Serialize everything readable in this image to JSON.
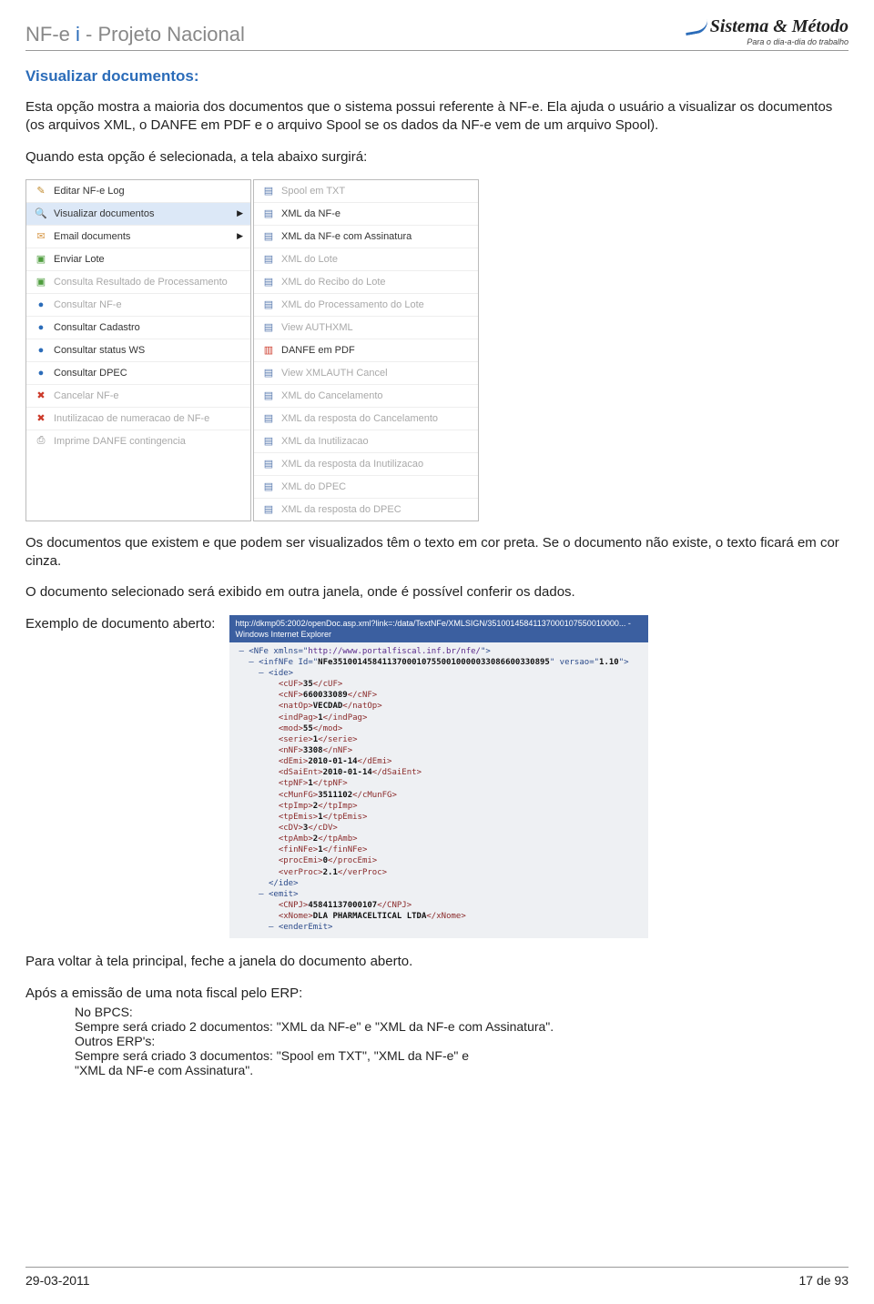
{
  "header": {
    "left_prefix": "NF-e ",
    "left_i": "i",
    "left_suffix": " - Projeto Nacional",
    "brand_name": "Sistema & Método",
    "brand_tag": "Para o dia-a-dia do trabalho"
  },
  "section_title": "Visualizar documentos:",
  "p1": "Esta opção mostra a maioria dos documentos que o sistema possui referente à NF-e. Ela ajuda o usuário a visualizar os documentos (os arquivos XML, o DANFE em PDF e o arquivo Spool se os dados da NF-e vem de um arquivo Spool).",
  "p2": "Quando esta opção é selecionada, a tela abaixo surgirá:",
  "menu_left": [
    {
      "icon": "pencil",
      "label": "Editar NF-e Log",
      "dim": false,
      "hl": false,
      "arrow": false
    },
    {
      "icon": "mag",
      "label": "Visualizar documentos",
      "dim": false,
      "hl": true,
      "arrow": true
    },
    {
      "icon": "mail",
      "label": "Email documents",
      "dim": false,
      "hl": false,
      "arrow": true
    },
    {
      "icon": "green",
      "label": "Enviar Lote",
      "dim": false,
      "hl": false,
      "arrow": false
    },
    {
      "icon": "green",
      "label": "Consulta Resultado de Processamento",
      "dim": true,
      "hl": false,
      "arrow": false
    },
    {
      "icon": "blue",
      "label": "Consultar NF-e",
      "dim": true,
      "hl": false,
      "arrow": false
    },
    {
      "icon": "blue",
      "label": "Consultar Cadastro",
      "dim": false,
      "hl": false,
      "arrow": false
    },
    {
      "icon": "blue",
      "label": "Consultar status WS",
      "dim": false,
      "hl": false,
      "arrow": false
    },
    {
      "icon": "blue",
      "label": "Consultar DPEC",
      "dim": false,
      "hl": false,
      "arrow": false
    },
    {
      "icon": "red",
      "label": "Cancelar NF-e",
      "dim": true,
      "hl": false,
      "arrow": false
    },
    {
      "icon": "red",
      "label": "Inutilizacao de numeracao de NF-e",
      "dim": true,
      "hl": false,
      "arrow": false
    },
    {
      "icon": "print",
      "label": "Imprime DANFE contingencia",
      "dim": true,
      "hl": false,
      "arrow": false
    }
  ],
  "menu_right": [
    {
      "icon": "doc",
      "label": "Spool em TXT",
      "dim": true
    },
    {
      "icon": "doc",
      "label": "XML da NF-e",
      "dim": false
    },
    {
      "icon": "doc",
      "label": "XML da NF-e com Assinatura",
      "dim": false
    },
    {
      "icon": "doc",
      "label": "XML do Lote",
      "dim": true
    },
    {
      "icon": "doc",
      "label": "XML do Recibo do Lote",
      "dim": true
    },
    {
      "icon": "doc",
      "label": "XML do Processamento do Lote",
      "dim": true
    },
    {
      "icon": "doc",
      "label": "View AUTHXML",
      "dim": true
    },
    {
      "icon": "pdf",
      "label": "DANFE em PDF",
      "dim": false
    },
    {
      "icon": "doc",
      "label": "View XMLAUTH Cancel",
      "dim": true
    },
    {
      "icon": "doc",
      "label": "XML do Cancelamento",
      "dim": true
    },
    {
      "icon": "doc",
      "label": "XML da resposta do Cancelamento",
      "dim": true
    },
    {
      "icon": "doc",
      "label": "XML da Inutilizacao",
      "dim": true
    },
    {
      "icon": "doc",
      "label": "XML da resposta da Inutilizacao",
      "dim": true
    },
    {
      "icon": "doc",
      "label": "XML do DPEC",
      "dim": true
    },
    {
      "icon": "doc",
      "label": "XML da resposta do DPEC",
      "dim": true
    }
  ],
  "p3": "Os documentos que existem e que podem ser visualizados têm o texto em cor preta. Se o documento não existe, o texto ficará em cor cinza.",
  "p4": "O documento selecionado será exibido em outra janela, onde é possível conferir os dados.",
  "exemplo_label": "Exemplo de documento aberto:",
  "xml": {
    "title": "http://dkmp05:2002/openDoc.asp.xml?link=:/data/TextNFe/XMLSIGN/35100145841137000107550010000... - Windows Internet Explorer",
    "ns": "http://www.portalfiscal.inf.br/nfe/",
    "infId": "NFe35100145841137000107550010000033086600330895",
    "versao": "1.10",
    "cuf": "35",
    "cnf": "660033089",
    "natop": "VECDAD",
    "indpag": "1",
    "mod": "55",
    "serie": "1",
    "nnf": "3308",
    "demi": "2010-01-14",
    "dsaient": "2010-01-14",
    "tpnf": "1",
    "cmunfg": "3511102",
    "tpimp": "2",
    "tpemis": "1",
    "cdv": "3",
    "tpamb": "2",
    "finnfe": "1",
    "procemi": "0",
    "verproc": "2.1",
    "cnpj": "45841137000107",
    "xnome": "DLA PHARMACELTICAL LTDA"
  },
  "p5": "Para voltar à tela principal, feche a janela do documento aberto.",
  "p6": "Após a emissão de uma nota fiscal pelo ERP:",
  "l1": "No BPCS:",
  "l2": "Sempre será criado 2 documentos: \"XML da NF-e\" e \"XML da NF-e com Assinatura\".",
  "l3": "Outros ERP's:",
  "l4": "Sempre será criado 3 documentos: \"Spool em TXT\", \"XML da NF-e\" e",
  "l5": "\"XML da NF-e com Assinatura\".",
  "footer": {
    "date": "29-03-2011",
    "page": "17 de 93"
  }
}
